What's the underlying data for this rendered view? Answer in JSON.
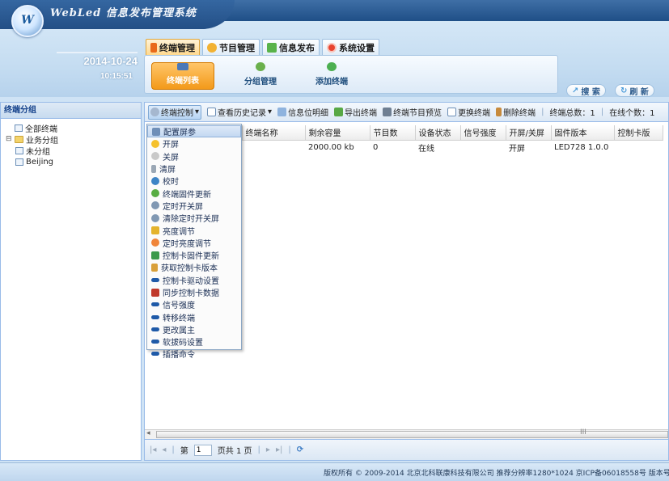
{
  "app": {
    "title": "WebLed 信息发布管理系统",
    "logo_text": "W"
  },
  "clock": {
    "date": "2014-10-24",
    "time": "10:15:51"
  },
  "main_nav": [
    {
      "label": "终端管理",
      "active": true,
      "icon": "terminal-icon"
    },
    {
      "label": "节目管理",
      "active": false,
      "icon": "program-icon"
    },
    {
      "label": "信息发布",
      "active": false,
      "icon": "publish-icon"
    },
    {
      "label": "系统设置",
      "active": false,
      "icon": "settings-icon"
    }
  ],
  "sub_nav": [
    {
      "label": "终端列表",
      "active": true
    },
    {
      "label": "分组管理",
      "active": false
    },
    {
      "label": "添加终端",
      "active": false
    }
  ],
  "header_buttons": {
    "search": "搜 索",
    "refresh": "刷 新"
  },
  "left_panel": {
    "title": "终端分组",
    "tree": [
      {
        "label": "全部终端",
        "level": 0
      },
      {
        "label": "业务分组",
        "level": 0,
        "folder": true
      },
      {
        "label": "未分组",
        "level": 1
      },
      {
        "label": "Beijing",
        "level": 1
      }
    ]
  },
  "toolbar": {
    "items": [
      "终端控制",
      "查看历史记录",
      "信息位明细",
      "导出终端",
      "终端节目预览",
      "更换终端",
      "删除终端"
    ],
    "total_label": "终端总数：1",
    "online_label": "在线个数：1"
  },
  "grid": {
    "columns": [
      "终端名称",
      "剩余容量",
      "节目数",
      "设备状态",
      "信号强度",
      "开屏/关屏",
      "固件版本",
      "控制卡版"
    ],
    "rows": [
      [
        "",
        "2000.00 kb",
        "0",
        "在线",
        "",
        "开屏",
        "LED728 1.0.0",
        ""
      ]
    ]
  },
  "menu": {
    "items": [
      "配置屏参",
      "开屏",
      "关屏",
      "清屏",
      "校时",
      "终端固件更新",
      "定时开关屏",
      "清除定时开关屏",
      "亮度调节",
      "定时亮度调节",
      "控制卡固件更新",
      "获取控制卡版本",
      "控制卡驱动设置",
      "同步控制卡数据",
      "信号强度",
      "转移终端",
      "更改属主",
      "软拔码设置",
      "插播命令"
    ]
  },
  "pager": {
    "page_prefix": "第",
    "page_value": "1",
    "page_suffix": "页共 1 页"
  },
  "footer": {
    "text": "版权所有 © 2009-2014 北京北科联康科技有限公司 推荐分辨率1280*1024 京ICP备06018558号 版本号"
  },
  "colors": {
    "accent": "#f39a1a",
    "header_dark": "#1f4f87",
    "panel_border": "#99bbe8"
  }
}
